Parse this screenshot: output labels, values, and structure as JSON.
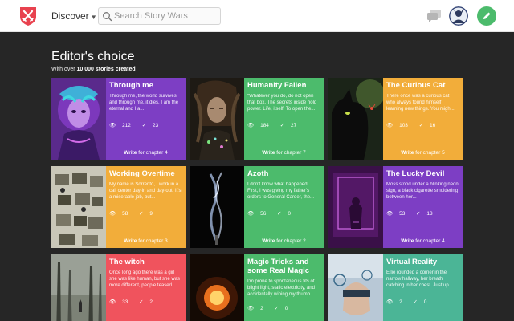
{
  "header": {
    "discover_label": "Discover",
    "search_placeholder": "Search Story Wars"
  },
  "section": {
    "title": "Editor's choice",
    "subtitle_prefix": "With over ",
    "subtitle_count": "10 000 stories created",
    "subtitle_suffix": ""
  },
  "cards": [
    {
      "title": "Through me",
      "excerpt": "Through me, the world survives and through me, it dies. I am the eternal and I a...",
      "views": "212",
      "votes": "23",
      "write": "Write",
      "chapter": "for chapter 4",
      "color": "#7d3ec4"
    },
    {
      "title": "Humanity Fallen",
      "excerpt": "\"Whatever you do, do not open that box. The secrets inside hold power. Life, itself. To open the...",
      "views": "184",
      "votes": "27",
      "write": "Write",
      "chapter": "for chapter 7",
      "color": "#4cbb6c"
    },
    {
      "title": "The Curious Cat",
      "excerpt": "There once was a curious cat who always found himself learning new things. You migh...",
      "views": "103",
      "votes": "16",
      "write": "Write",
      "chapter": "for chapter 5",
      "color": "#f2ad3a"
    },
    {
      "title": "Working Overtime",
      "excerpt": "My name is Sorrento, I work in a call center day-in and day-out. It's a miserable job, but...",
      "views": "58",
      "votes": "9",
      "write": "Write",
      "chapter": "for chapter 3",
      "color": "#f2ad3a"
    },
    {
      "title": "Azoth",
      "excerpt": "I don't know what happened. First, I was giving my father's orders to General Carder, the...",
      "views": "56",
      "votes": "0",
      "write": "Write",
      "chapter": "for chapter 2",
      "color": "#4cbb6c"
    },
    {
      "title": "The Lucky Devil",
      "excerpt": "Moss stood under a blinking neon sign, a black cigarette smoldering between her...",
      "views": "53",
      "votes": "13",
      "write": "Write",
      "chapter": "for chapter 4",
      "color": "#7d3ec4"
    },
    {
      "title": "The witch",
      "excerpt": "Once long ago there was a girl she was like human, but she was more different, people teased...",
      "views": "33",
      "votes": "2",
      "write": "Write",
      "chapter": "for chapter 2",
      "color": "#f0535d"
    },
    {
      "title": "Magic Tricks and some Real Magic",
      "excerpt": "I'm prone to spontaneous fits of blight light, static electricity, and accidentally wiping my thumb...",
      "views": "2",
      "votes": "0",
      "write": "Write",
      "chapter": "for chapter 2",
      "color": "#4cbb6c"
    },
    {
      "title": "Virtual Reality",
      "excerpt": "Ellie rounded a corner in the narrow hallway, her breath catching in her chest. Just up...",
      "views": "2",
      "votes": "0",
      "write": "Write",
      "chapter": "for chapter 2",
      "color": "#4bb596"
    }
  ]
}
